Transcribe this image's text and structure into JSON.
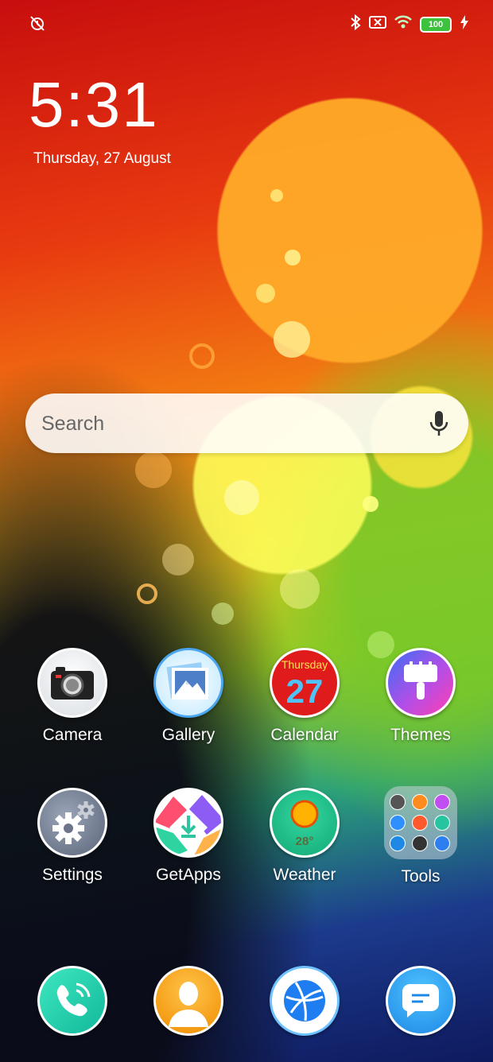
{
  "status_bar": {
    "left_icons": [
      "alarm-off-icon"
    ],
    "right_icons": [
      "bluetooth-icon",
      "no-sim-icon",
      "wifi-icon",
      "battery-icon",
      "charging-icon"
    ],
    "battery_level": "100"
  },
  "clock": {
    "time": "5:31",
    "date": "Thursday, 27 August"
  },
  "search": {
    "placeholder": "Search"
  },
  "apps": {
    "camera": {
      "label": "Camera"
    },
    "gallery": {
      "label": "Gallery"
    },
    "calendar": {
      "label": "Calendar",
      "day_name": "Thursday",
      "day_number": "27"
    },
    "themes": {
      "label": "Themes"
    },
    "settings": {
      "label": "Settings"
    },
    "getapps": {
      "label": "GetApps"
    },
    "weather": {
      "label": "Weather",
      "temperature": "28°"
    },
    "tools": {
      "label": "Tools"
    }
  },
  "dock": [
    "phone-icon",
    "contacts-icon",
    "browser-icon",
    "messages-icon"
  ],
  "colors": {
    "battery": "#3cc23c",
    "calendar_red": "#e01b1b",
    "calendar_blue": "#4fc3f7"
  }
}
